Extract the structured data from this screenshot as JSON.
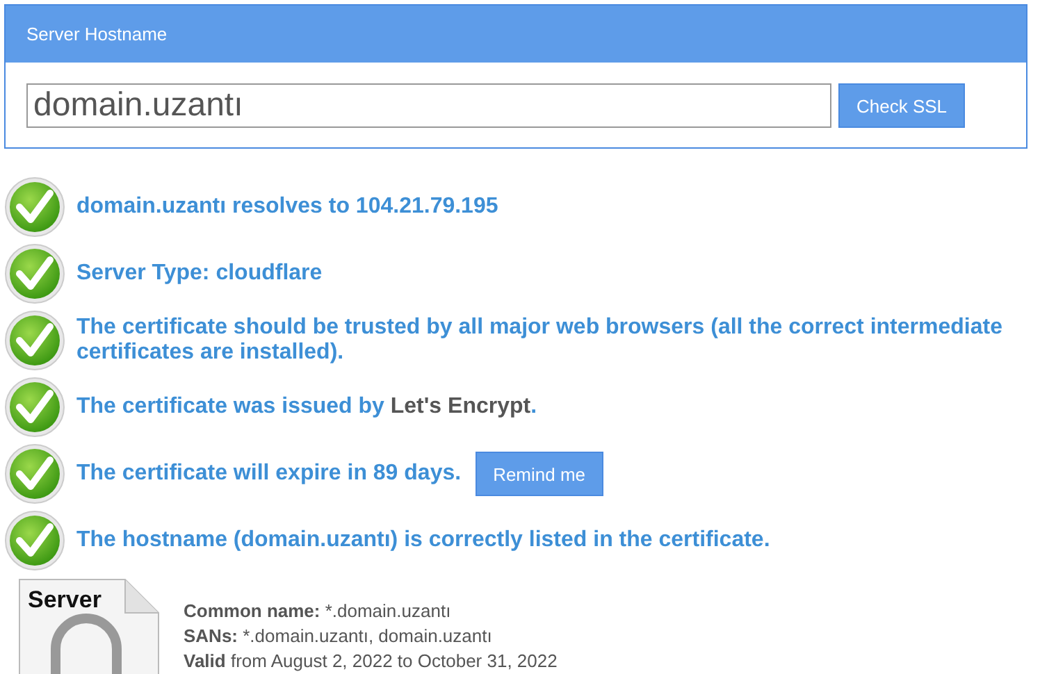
{
  "panel": {
    "title": "Server Hostname",
    "input": {
      "value": "domain.uzantı"
    },
    "button": "Check SSL"
  },
  "checks": [
    {
      "kind": "plain",
      "text": "domain.uzantı resolves to 104.21.79.195"
    },
    {
      "kind": "plain",
      "text": "Server Type: cloudflare"
    },
    {
      "kind": "plain",
      "text": "The certificate should be trusted by all major web browsers (all the correct intermediate certificates are installed)."
    },
    {
      "kind": "issuer",
      "text": "The certificate was issued by",
      "issuer": "Let's Encrypt",
      "after": "."
    },
    {
      "kind": "action",
      "text": "The certificate will expire in 89 days.",
      "button": "Remind me"
    },
    {
      "kind": "plain",
      "text": "The hostname (domain.uzantı) is correctly listed in the certificate."
    }
  ],
  "certificate": {
    "badge": "Server",
    "details": [
      "**Common name:** *.domain.uzantı",
      "**SANs:** *.domain.uzantı, domain.uzantı",
      "**Valid** from August 2, 2022 to October 31, 2022"
    ]
  }
}
